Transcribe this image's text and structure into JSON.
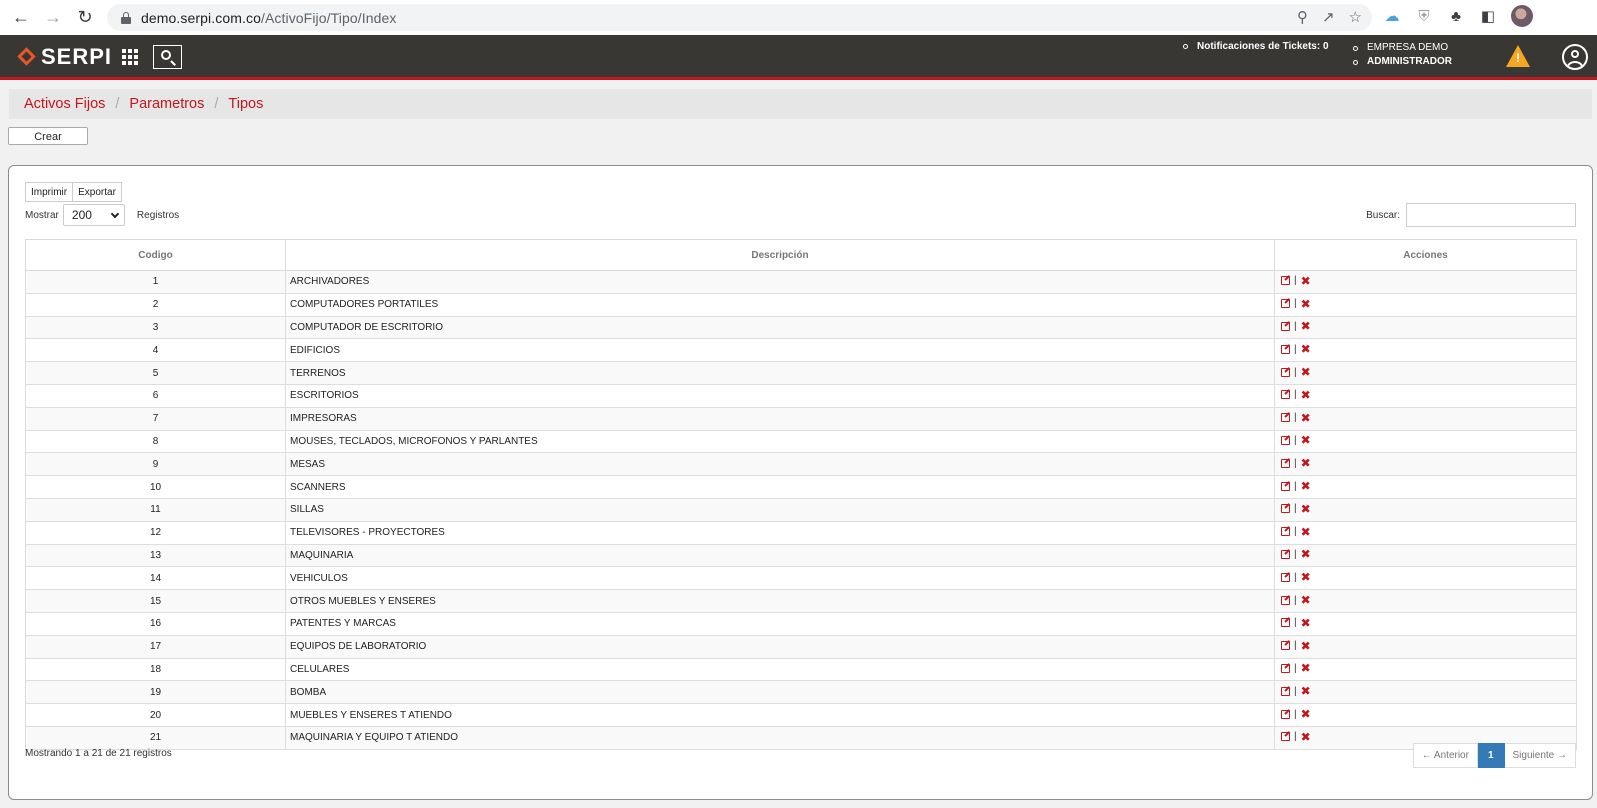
{
  "browser": {
    "url_host": "demo.serpi.com.co",
    "url_path": "/ActivoFijo/Tipo/Index"
  },
  "header": {
    "logo_text": "SERPI",
    "notifications_label": "Notificaciones de Tickets: 0",
    "company": "EMPRESA DEMO",
    "role": "ADMINISTRADOR"
  },
  "breadcrumb": [
    "Activos Fijos",
    "Parametros",
    "Tipos"
  ],
  "create_label": "Crear",
  "toolbar": {
    "print_label": "Imprimir",
    "export_label": "Exportar"
  },
  "length": {
    "show_label": "Mostrar",
    "value": "200",
    "records_label": "Registros"
  },
  "search": {
    "label": "Buscar:",
    "value": ""
  },
  "table": {
    "columns": [
      "Codigo",
      "Descripción",
      "Acciones"
    ],
    "rows": [
      {
        "code": "1",
        "desc": "ARCHIVADORES"
      },
      {
        "code": "2",
        "desc": "COMPUTADORES PORTATILES"
      },
      {
        "code": "3",
        "desc": "COMPUTADOR DE ESCRITORIO"
      },
      {
        "code": "4",
        "desc": "EDIFICIOS"
      },
      {
        "code": "5",
        "desc": "TERRENOS"
      },
      {
        "code": "6",
        "desc": "ESCRITORIOS"
      },
      {
        "code": "7",
        "desc": "IMPRESORAS"
      },
      {
        "code": "8",
        "desc": "MOUSES, TECLADOS, MICROFONOS Y PARLANTES"
      },
      {
        "code": "9",
        "desc": "MESAS"
      },
      {
        "code": "10",
        "desc": "SCANNERS"
      },
      {
        "code": "11",
        "desc": "SILLAS"
      },
      {
        "code": "12",
        "desc": "TELEVISORES - PROYECTORES"
      },
      {
        "code": "13",
        "desc": "MAQUINARIA"
      },
      {
        "code": "14",
        "desc": "VEHICULOS"
      },
      {
        "code": "15",
        "desc": "OTROS MUEBLES Y ENSERES"
      },
      {
        "code": "16",
        "desc": "PATENTES Y MARCAS"
      },
      {
        "code": "17",
        "desc": "EQUIPOS DE LABORATORIO"
      },
      {
        "code": "18",
        "desc": "CELULARES"
      },
      {
        "code": "19",
        "desc": "BOMBA"
      },
      {
        "code": "20",
        "desc": "MUEBLES Y ENSERES T ATIENDO"
      },
      {
        "code": "21",
        "desc": "MAQUINARIA Y EQUIPO T ATIENDO"
      }
    ]
  },
  "info": "Mostrando 1 a 21 de 21 registros",
  "pagination": {
    "prev": "← Anterior",
    "current": "1",
    "next": "Siguiente →"
  },
  "colors": {
    "brand_red": "#c3161c",
    "header_bg": "#393734",
    "page_active": "#337ab7"
  }
}
